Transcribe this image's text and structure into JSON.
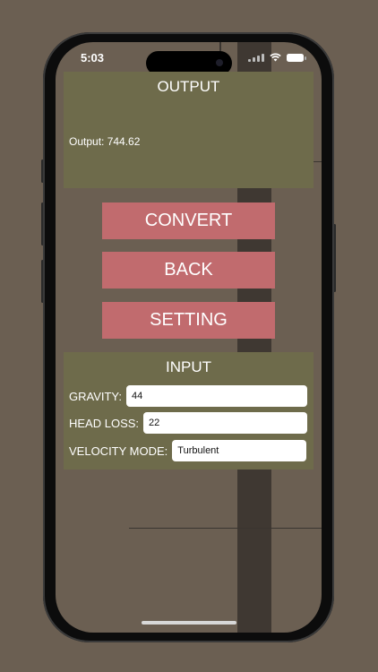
{
  "status": {
    "time": "5:03"
  },
  "output_panel": {
    "title": "OUTPUT",
    "result_text": "Output: 744.62"
  },
  "buttons": {
    "convert": "CONVERT",
    "back": "BACK",
    "setting": "SETTING"
  },
  "input_panel": {
    "title": "INPUT",
    "fields": [
      {
        "label": "GRAVITY:",
        "value": "44"
      },
      {
        "label": "HEAD LOSS:",
        "value": "22"
      },
      {
        "label": "VELOCITY MODE:",
        "value": "Turbulent"
      }
    ]
  },
  "colors": {
    "background": "#6b5f52",
    "panel": "#6e6b4b",
    "button": "#c16b6e",
    "dark_bar": "#3f3832"
  }
}
